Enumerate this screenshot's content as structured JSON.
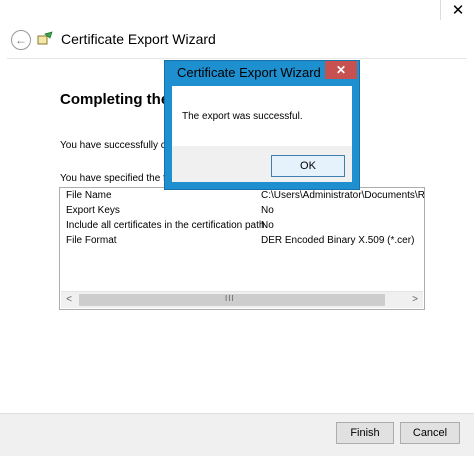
{
  "window": {
    "close_glyph": "✕"
  },
  "wizard": {
    "title": "Certificate Export Wizard",
    "heading": "Completing the",
    "text1": "You have successfully co",
    "text2": "You have specified the fo",
    "rows": [
      {
        "key": "File Name",
        "value": "C:\\Users\\Administrator\\Documents\\Ro"
      },
      {
        "key": "Export Keys",
        "value": "No"
      },
      {
        "key": "Include all certificates in the certification path",
        "value": "No"
      },
      {
        "key": "File Format",
        "value": "DER Encoded Binary X.509 (*.cer)"
      }
    ],
    "buttons": {
      "finish": "Finish",
      "cancel": "Cancel"
    }
  },
  "dialog": {
    "title": "Certificate Export Wizard",
    "message": "The export was successful.",
    "ok": "OK",
    "close_glyph": "✕"
  },
  "colors": {
    "accent": "#1e8fcf",
    "close_red": "#c75050"
  }
}
